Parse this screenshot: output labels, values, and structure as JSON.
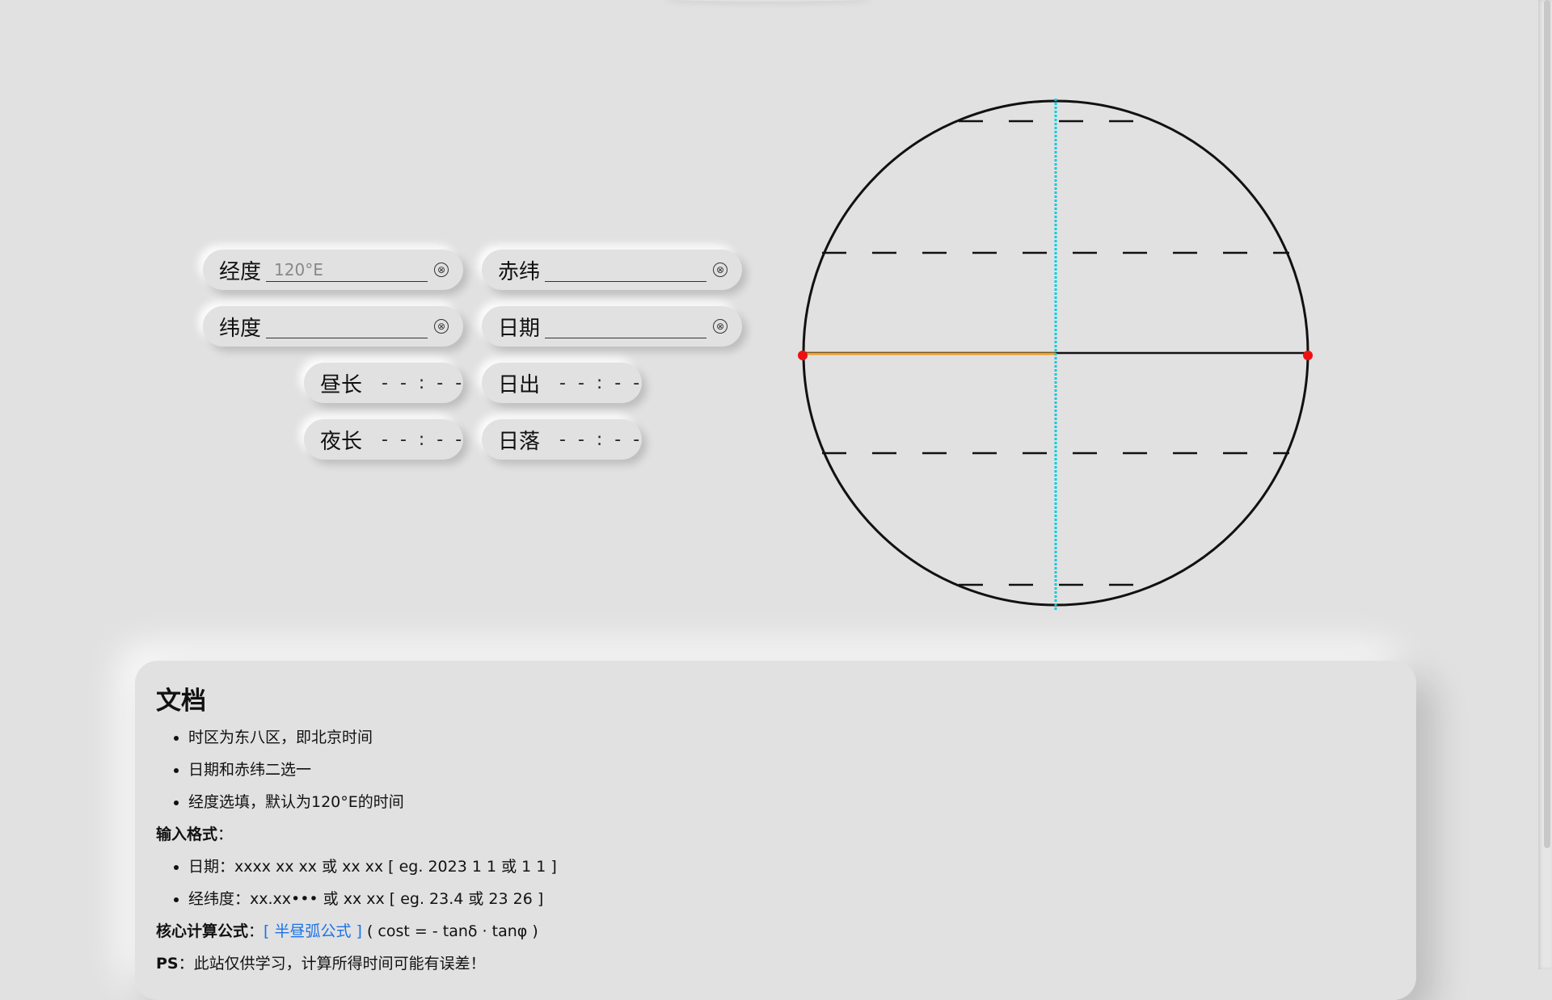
{
  "inputs": [
    {
      "label": "经度",
      "placeholder": "120°E",
      "value": ""
    },
    {
      "label": "赤纬",
      "placeholder": "",
      "value": ""
    },
    {
      "label": "纬度",
      "placeholder": "",
      "value": ""
    },
    {
      "label": "日期",
      "placeholder": "",
      "value": ""
    }
  ],
  "clear_glyph": "⊗",
  "outputs": [
    {
      "label": "昼长",
      "value": "- - : - -"
    },
    {
      "label": "日出",
      "value": "- - : - -"
    },
    {
      "label": "夜长",
      "value": "- - : - -"
    },
    {
      "label": "日落",
      "value": "- - : - -"
    }
  ],
  "docs": {
    "title": "文档",
    "notes": [
      "时区为东八区，即北京时间",
      "日期和赤纬二选一",
      "经度选填，默认为120°E的时间"
    ],
    "format_heading": "输入格式",
    "colon": "：",
    "formats": [
      "日期：xxxx xx xx 或 xx xx [ eg. 2023 1 1 或 1 1 ]",
      "经纬度：xx.xx••• 或 xx xx [ eg. 23.4 或 23 26 ]"
    ],
    "formula_heading": "核心计算公式",
    "formula_link": "[ 半昼弧公式 ]",
    "formula_text": "( cost = - tanδ · tanφ )",
    "ps_heading": "PS",
    "ps_text": "此站仅供学习，计算所得时间可能有误差！"
  },
  "diagram_colors": {
    "circle": "#111111",
    "meridian": "#00d0e0",
    "day_arc": "#f0a020",
    "sun_points": "#ee1111"
  }
}
